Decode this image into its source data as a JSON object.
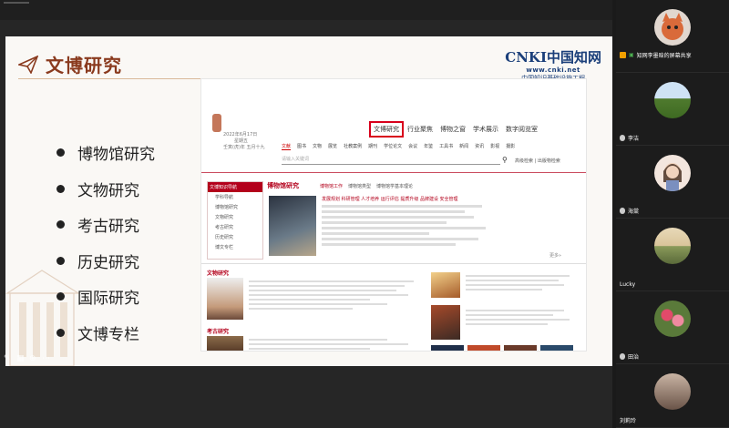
{
  "slide": {
    "title": "文博研究",
    "bullets": [
      "博物馆研究",
      "文物研究",
      "考古研究",
      "历史研究",
      "国际研究",
      "文博专栏"
    ],
    "logo": {
      "mark": "CNKI中国知网",
      "url": "www.cnki.net",
      "org": "中国知识基础设施工程"
    }
  },
  "web": {
    "nav": [
      "文博研究",
      "行业聚焦",
      "博物之窗",
      "学术展示",
      "数字阅览室"
    ],
    "date": "2022年6月17日",
    "weekday": "星期五",
    "lunar": "壬寅(虎)年 五月十九",
    "menu": [
      "文献",
      "图书",
      "文物",
      "展览",
      "社教案例",
      "期刊",
      "学位论文",
      "会议",
      "年鉴",
      "工具书",
      "新闻",
      "资讯",
      "影视",
      "摄影"
    ],
    "search_placeholder": "请输入关键词",
    "search_extra": "高级检索 | 出版物检索",
    "side_title": "文博知识导航",
    "side_items": [
      "学科导航",
      "博物馆研究",
      "文物研究",
      "考古研究",
      "历史研究",
      "博文专栏"
    ],
    "main_title": "博物馆研究",
    "main_tabs": [
      "博物馆工作",
      "博物馆类型",
      "博物馆学基本理论"
    ],
    "main_first": "发展规划  科研管理  人才培养  运行评估  提质升级  品牌建设  安全管理",
    "sec_relic": "文物研究",
    "sec_archaeo": "考古研究",
    "more": "更多»"
  },
  "participants": [
    {
      "name": "知网李墨晗的屏幕共享",
      "avatar": "fox"
    },
    {
      "name": "李洁",
      "avatar": "field"
    },
    {
      "name": "海棠",
      "avatar": "girl"
    },
    {
      "name": "Lucky",
      "avatar": "landscape"
    },
    {
      "name": "田治",
      "avatar": "flowers"
    },
    {
      "name": "刘莉玲",
      "avatar": "person"
    }
  ]
}
